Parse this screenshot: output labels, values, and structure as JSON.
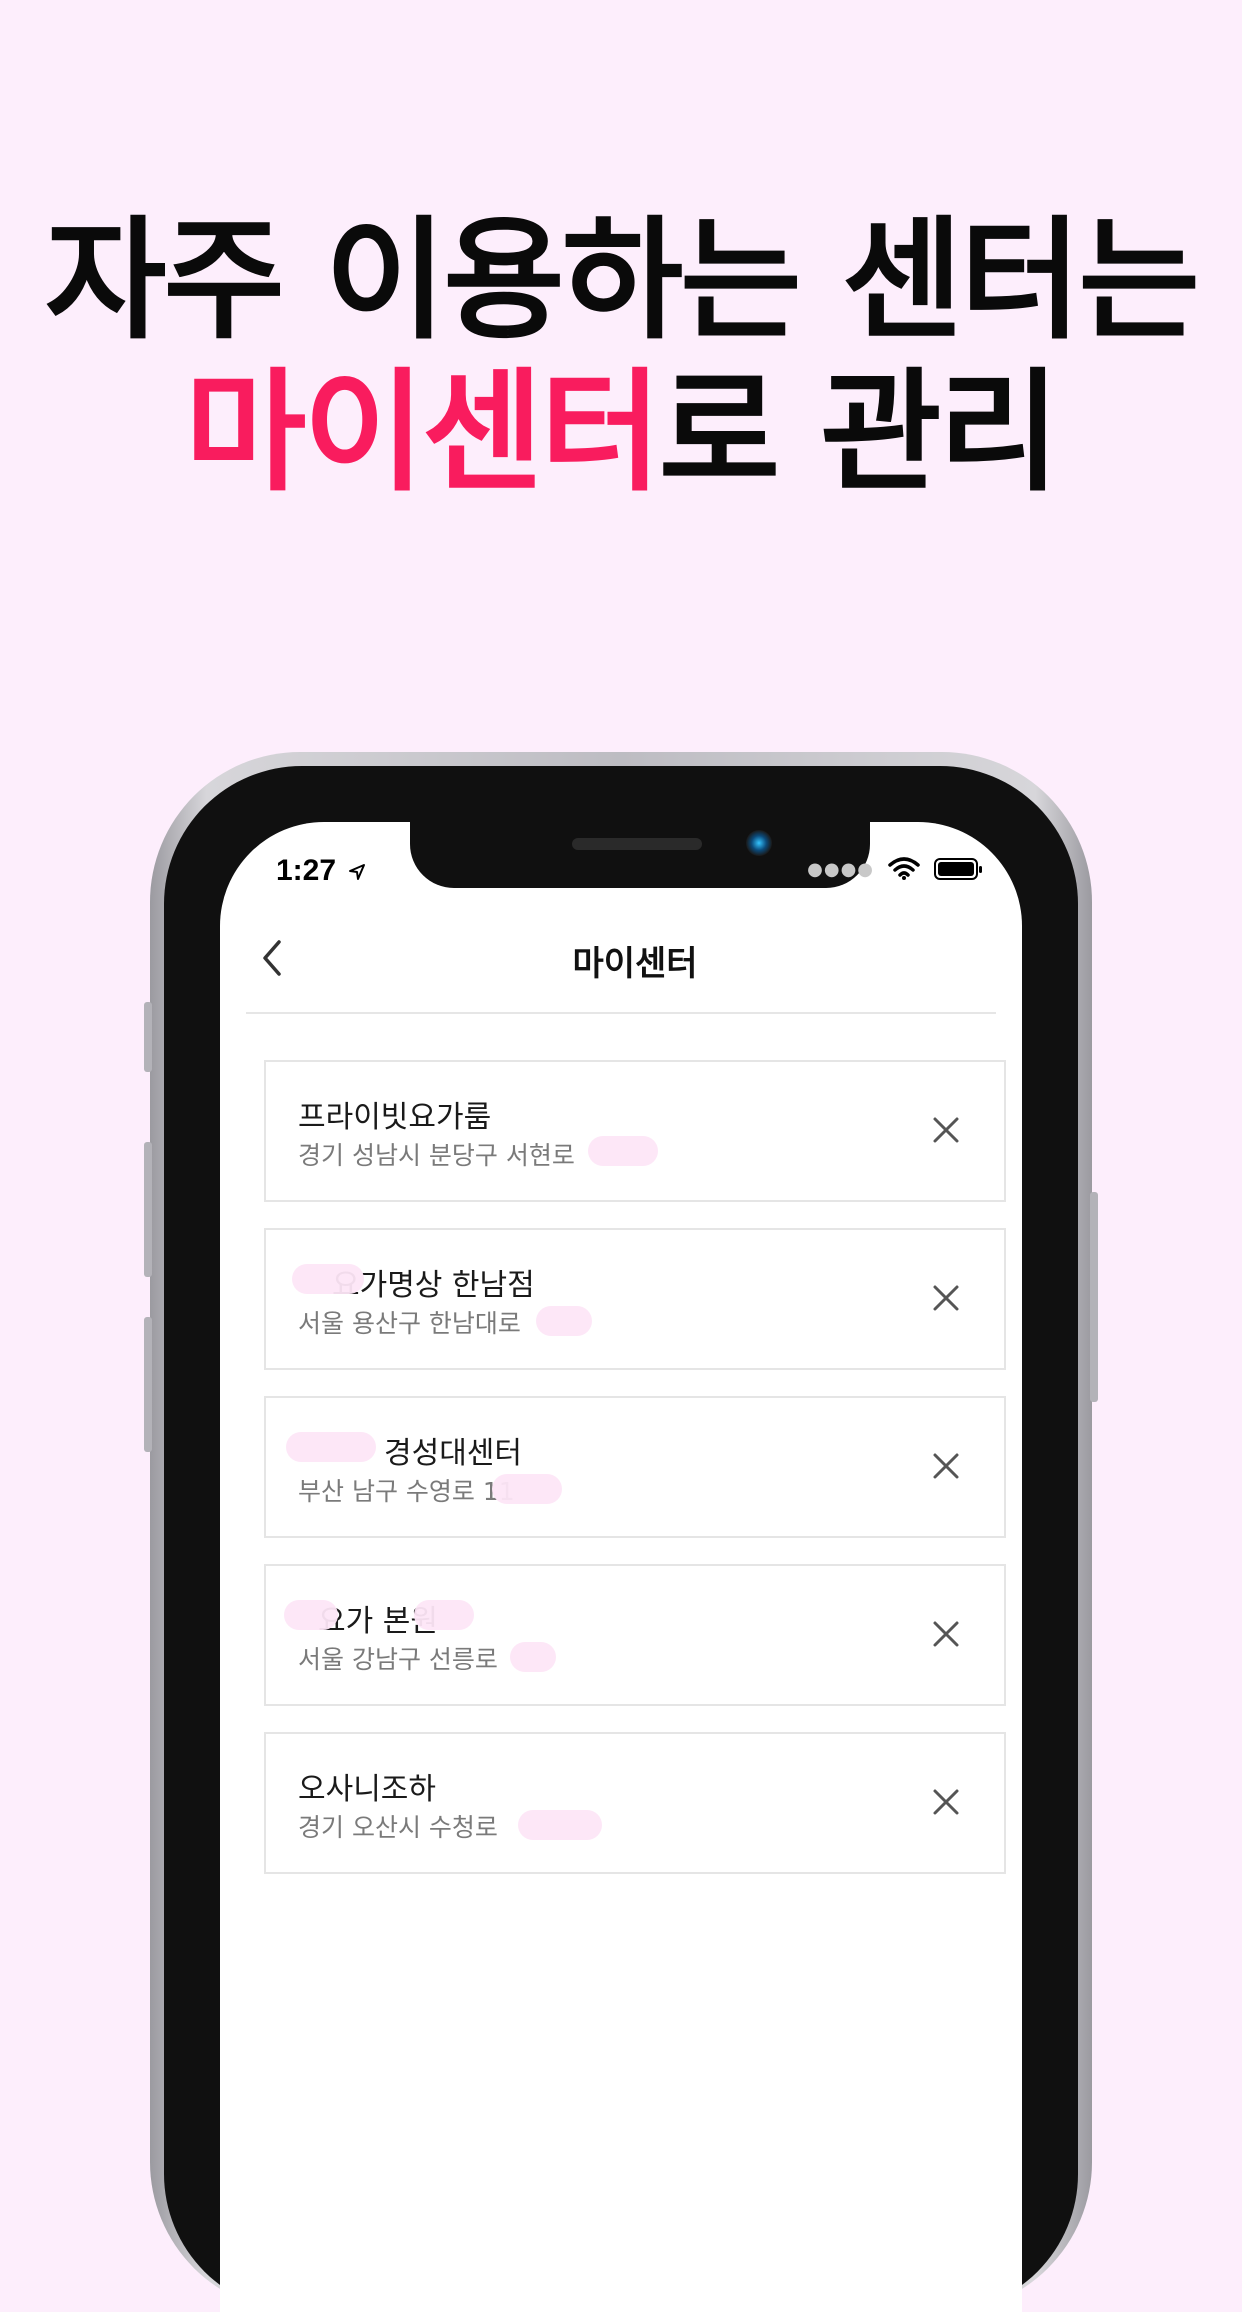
{
  "headline": {
    "line1": "자주 이용하는 센터는",
    "line2_accent": "마이센터",
    "line2_rest": "로 관리"
  },
  "status_bar": {
    "time": "1:27"
  },
  "nav": {
    "title": "마이센터"
  },
  "centers": [
    {
      "name": "프라이빗요가룸",
      "address": "경기 성남시 분당구 서현로"
    },
    {
      "name": "요가명상 한남점",
      "address": "서울 용산구 한남대로"
    },
    {
      "name": "경성대센터",
      "address": "부산 남구 수영로 11"
    },
    {
      "name": "요가 본원",
      "address": "서울 강남구 선릉로"
    },
    {
      "name": "오사니조하",
      "address": "경기 오산시 수청로"
    }
  ],
  "colors": {
    "accent": "#f91c5e",
    "background": "#fdeefc"
  }
}
